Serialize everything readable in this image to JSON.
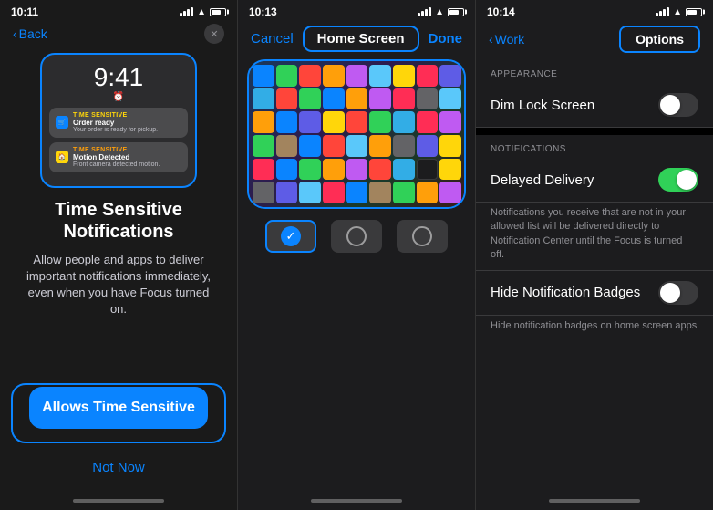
{
  "panel1": {
    "status_time": "10:11",
    "nav_back": "Back",
    "lockscreen_time": "9:41",
    "notif1_label": "TIME SENSITIVE",
    "notif1_title": "Order ready",
    "notif1_body": "Your order is ready for pickup.",
    "notif2_label": "TIME SENSITIVE",
    "notif2_title": "Motion Detected",
    "notif2_body": "Front camera detected motion.",
    "title": "Time Sensitive Notifications",
    "body": "Allow people and apps to deliver important notifications immediately, even when you have Focus turned on.",
    "btn_allows": "Allows Time Sensitive",
    "btn_not_now": "Not Now"
  },
  "panel2": {
    "status_time": "10:13",
    "nav_cancel": "Cancel",
    "nav_title": "Home Screen",
    "nav_done": "Done",
    "option1_selected": true,
    "option2_selected": false,
    "option3_selected": false
  },
  "panel3": {
    "status_time": "10:14",
    "nav_back": "Work",
    "tab_options": "Options",
    "section_appearance": "APPEARANCE",
    "row_dim_lock": "Dim Lock Screen",
    "section_notifications": "NOTIFICATIONS",
    "row_delayed": "Delayed Delivery",
    "delayed_note": "Notifications you receive that are not in your allowed list will be delivered directly to Notification Center until the Focus is turned off.",
    "row_hide_badges": "Hide Notification Badges",
    "badges_note": "Hide notification badges on home screen apps",
    "dim_lock_on": false,
    "delayed_delivery_on": true,
    "hide_badges_on": false
  }
}
